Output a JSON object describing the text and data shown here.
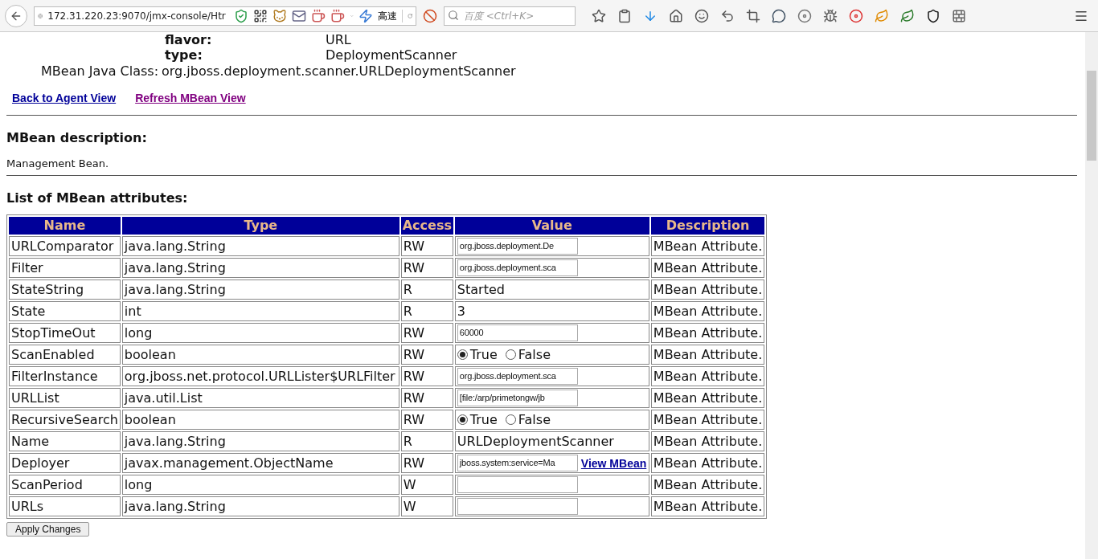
{
  "browser": {
    "url": "172.31.220.23:9070/jmx-console/Htr",
    "speed_label": "高速",
    "search": {
      "placeholder": "百度 <Ctrl+K>"
    }
  },
  "properties": [
    {
      "key": "flavor:",
      "value": "URL"
    },
    {
      "key": "type:",
      "value": "DeploymentScanner"
    }
  ],
  "java_class": {
    "label": "MBean Java Class:",
    "value": "org.jboss.deployment.scanner.URLDeploymentScanner"
  },
  "links": [
    {
      "label": "Back to Agent View",
      "visited": false
    },
    {
      "label": "Refresh MBean View",
      "visited": true
    }
  ],
  "description": {
    "heading": "MBean description:",
    "text": "Management Bean."
  },
  "attributes": {
    "heading": "List of MBean attributes:",
    "columns": [
      "Name",
      "Type",
      "Access",
      "Value",
      "Description"
    ],
    "rows": [
      {
        "name": "URLComparator",
        "type": "java.lang.String",
        "access": "RW",
        "value": {
          "kind": "input",
          "text": "org.jboss.deployment.De"
        },
        "description": "MBean Attribute."
      },
      {
        "name": "Filter",
        "type": "java.lang.String",
        "access": "RW",
        "value": {
          "kind": "input",
          "text": "org.jboss.deployment.sca"
        },
        "description": "MBean Attribute."
      },
      {
        "name": "StateString",
        "type": "java.lang.String",
        "access": "R",
        "value": {
          "kind": "text",
          "text": "Started"
        },
        "description": "MBean Attribute."
      },
      {
        "name": "State",
        "type": "int",
        "access": "R",
        "value": {
          "kind": "text",
          "text": "3"
        },
        "description": "MBean Attribute."
      },
      {
        "name": "StopTimeOut",
        "type": "long",
        "access": "RW",
        "value": {
          "kind": "input",
          "text": "60000"
        },
        "description": "MBean Attribute."
      },
      {
        "name": "ScanEnabled",
        "type": "boolean",
        "access": "RW",
        "value": {
          "kind": "radio",
          "options": [
            {
              "label": "True",
              "selected": true
            },
            {
              "label": "False",
              "selected": false
            }
          ]
        },
        "description": "MBean Attribute."
      },
      {
        "name": "FilterInstance",
        "type": "org.jboss.net.protocol.URLLister$URLFilter",
        "access": "RW",
        "value": {
          "kind": "input",
          "text": "org.jboss.deployment.sca"
        },
        "description": "MBean Attribute."
      },
      {
        "name": "URLList",
        "type": "java.util.List",
        "access": "RW",
        "value": {
          "kind": "input",
          "text": "[file:/arp/primetongw/jb"
        },
        "description": "MBean Attribute."
      },
      {
        "name": "RecursiveSearch",
        "type": "boolean",
        "access": "RW",
        "value": {
          "kind": "radio",
          "options": [
            {
              "label": "True",
              "selected": true
            },
            {
              "label": "False",
              "selected": false
            }
          ]
        },
        "description": "MBean Attribute."
      },
      {
        "name": "Name",
        "type": "java.lang.String",
        "access": "R",
        "value": {
          "kind": "text",
          "text": "URLDeploymentScanner"
        },
        "description": "MBean Attribute."
      },
      {
        "name": "Deployer",
        "type": "javax.management.ObjectName",
        "access": "RW",
        "value": {
          "kind": "input_link",
          "text": "jboss.system:service=Ma",
          "link": "View MBean"
        },
        "description": "MBean Attribute."
      },
      {
        "name": "ScanPeriod",
        "type": "long",
        "access": "W",
        "value": {
          "kind": "input"
        },
        "description": "MBean Attribute."
      },
      {
        "name": "URLs",
        "type": "java.lang.String",
        "access": "W",
        "value": {
          "kind": "input"
        },
        "description": "MBean Attribute."
      }
    ]
  },
  "apply_button": "Apply Changes"
}
